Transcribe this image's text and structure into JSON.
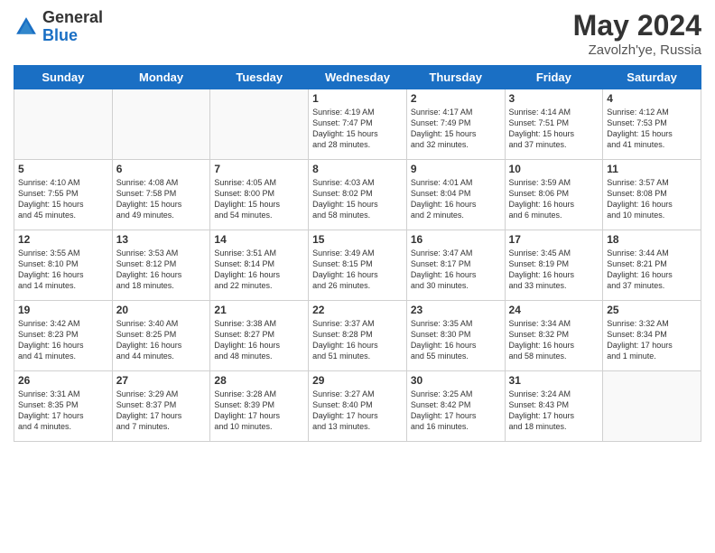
{
  "header": {
    "logo_general": "General",
    "logo_blue": "Blue",
    "title": "May 2024",
    "location": "Zavolzh'ye, Russia"
  },
  "days_of_week": [
    "Sunday",
    "Monday",
    "Tuesday",
    "Wednesday",
    "Thursday",
    "Friday",
    "Saturday"
  ],
  "weeks": [
    [
      {
        "day": "",
        "info": ""
      },
      {
        "day": "",
        "info": ""
      },
      {
        "day": "",
        "info": ""
      },
      {
        "day": "1",
        "info": "Sunrise: 4:19 AM\nSunset: 7:47 PM\nDaylight: 15 hours\nand 28 minutes."
      },
      {
        "day": "2",
        "info": "Sunrise: 4:17 AM\nSunset: 7:49 PM\nDaylight: 15 hours\nand 32 minutes."
      },
      {
        "day": "3",
        "info": "Sunrise: 4:14 AM\nSunset: 7:51 PM\nDaylight: 15 hours\nand 37 minutes."
      },
      {
        "day": "4",
        "info": "Sunrise: 4:12 AM\nSunset: 7:53 PM\nDaylight: 15 hours\nand 41 minutes."
      }
    ],
    [
      {
        "day": "5",
        "info": "Sunrise: 4:10 AM\nSunset: 7:55 PM\nDaylight: 15 hours\nand 45 minutes."
      },
      {
        "day": "6",
        "info": "Sunrise: 4:08 AM\nSunset: 7:58 PM\nDaylight: 15 hours\nand 49 minutes."
      },
      {
        "day": "7",
        "info": "Sunrise: 4:05 AM\nSunset: 8:00 PM\nDaylight: 15 hours\nand 54 minutes."
      },
      {
        "day": "8",
        "info": "Sunrise: 4:03 AM\nSunset: 8:02 PM\nDaylight: 15 hours\nand 58 minutes."
      },
      {
        "day": "9",
        "info": "Sunrise: 4:01 AM\nSunset: 8:04 PM\nDaylight: 16 hours\nand 2 minutes."
      },
      {
        "day": "10",
        "info": "Sunrise: 3:59 AM\nSunset: 8:06 PM\nDaylight: 16 hours\nand 6 minutes."
      },
      {
        "day": "11",
        "info": "Sunrise: 3:57 AM\nSunset: 8:08 PM\nDaylight: 16 hours\nand 10 minutes."
      }
    ],
    [
      {
        "day": "12",
        "info": "Sunrise: 3:55 AM\nSunset: 8:10 PM\nDaylight: 16 hours\nand 14 minutes."
      },
      {
        "day": "13",
        "info": "Sunrise: 3:53 AM\nSunset: 8:12 PM\nDaylight: 16 hours\nand 18 minutes."
      },
      {
        "day": "14",
        "info": "Sunrise: 3:51 AM\nSunset: 8:14 PM\nDaylight: 16 hours\nand 22 minutes."
      },
      {
        "day": "15",
        "info": "Sunrise: 3:49 AM\nSunset: 8:15 PM\nDaylight: 16 hours\nand 26 minutes."
      },
      {
        "day": "16",
        "info": "Sunrise: 3:47 AM\nSunset: 8:17 PM\nDaylight: 16 hours\nand 30 minutes."
      },
      {
        "day": "17",
        "info": "Sunrise: 3:45 AM\nSunset: 8:19 PM\nDaylight: 16 hours\nand 33 minutes."
      },
      {
        "day": "18",
        "info": "Sunrise: 3:44 AM\nSunset: 8:21 PM\nDaylight: 16 hours\nand 37 minutes."
      }
    ],
    [
      {
        "day": "19",
        "info": "Sunrise: 3:42 AM\nSunset: 8:23 PM\nDaylight: 16 hours\nand 41 minutes."
      },
      {
        "day": "20",
        "info": "Sunrise: 3:40 AM\nSunset: 8:25 PM\nDaylight: 16 hours\nand 44 minutes."
      },
      {
        "day": "21",
        "info": "Sunrise: 3:38 AM\nSunset: 8:27 PM\nDaylight: 16 hours\nand 48 minutes."
      },
      {
        "day": "22",
        "info": "Sunrise: 3:37 AM\nSunset: 8:28 PM\nDaylight: 16 hours\nand 51 minutes."
      },
      {
        "day": "23",
        "info": "Sunrise: 3:35 AM\nSunset: 8:30 PM\nDaylight: 16 hours\nand 55 minutes."
      },
      {
        "day": "24",
        "info": "Sunrise: 3:34 AM\nSunset: 8:32 PM\nDaylight: 16 hours\nand 58 minutes."
      },
      {
        "day": "25",
        "info": "Sunrise: 3:32 AM\nSunset: 8:34 PM\nDaylight: 17 hours\nand 1 minute."
      }
    ],
    [
      {
        "day": "26",
        "info": "Sunrise: 3:31 AM\nSunset: 8:35 PM\nDaylight: 17 hours\nand 4 minutes."
      },
      {
        "day": "27",
        "info": "Sunrise: 3:29 AM\nSunset: 8:37 PM\nDaylight: 17 hours\nand 7 minutes."
      },
      {
        "day": "28",
        "info": "Sunrise: 3:28 AM\nSunset: 8:39 PM\nDaylight: 17 hours\nand 10 minutes."
      },
      {
        "day": "29",
        "info": "Sunrise: 3:27 AM\nSunset: 8:40 PM\nDaylight: 17 hours\nand 13 minutes."
      },
      {
        "day": "30",
        "info": "Sunrise: 3:25 AM\nSunset: 8:42 PM\nDaylight: 17 hours\nand 16 minutes."
      },
      {
        "day": "31",
        "info": "Sunrise: 3:24 AM\nSunset: 8:43 PM\nDaylight: 17 hours\nand 18 minutes."
      },
      {
        "day": "",
        "info": ""
      }
    ]
  ]
}
